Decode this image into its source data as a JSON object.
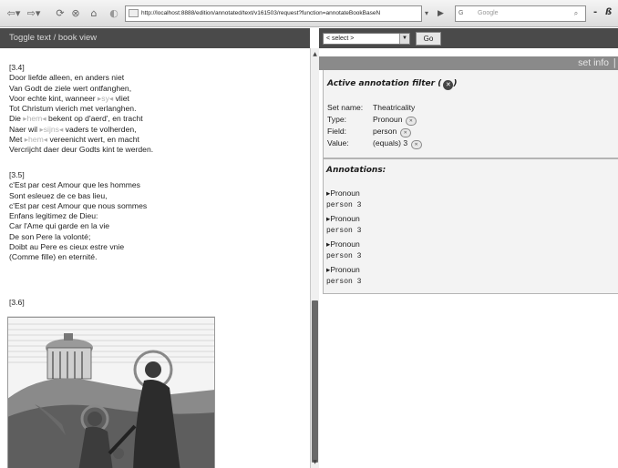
{
  "browser": {
    "url": "http://localhost:8888/edition/annotated/text/v161503/request?function=annotateBookBaseN",
    "search_placeholder": "Google",
    "search_engine_label": "G",
    "menu_dash": "-",
    "menu_extra": "ß"
  },
  "left": {
    "toggle_label": "Toggle text / book view",
    "stanza_34": {
      "number": "[3.4]",
      "lines": [
        [
          "Door liefde alleen, en anders niet",
          "",
          ""
        ],
        [
          "Van Godt de ziele wert ontfanghen,",
          "",
          ""
        ],
        [
          "Voor echte kint, wanneer ",
          "▸sy◂",
          " vliet"
        ],
        [
          "Tot Christum vierich met verlanghen.",
          "",
          ""
        ],
        [
          "Die ",
          "▸hem◂",
          " bekent op d'aerd', en tracht"
        ],
        [
          "Naer wil ",
          "▸sijns◂",
          " vaders te volherden,"
        ],
        [
          "Met ",
          "▸hem◂",
          " vereenicht wert, en macht"
        ],
        [
          "Vercrijcht daer deur Godts kint te werden.",
          "",
          ""
        ]
      ]
    },
    "stanza_35": {
      "number": "[3.5]",
      "lines": [
        "c'Est par cest Amour que les hommes",
        "Sont esleuez de ce bas lieu,",
        "c'Est par cest Amour que nous sommes",
        "Enfans legitimez de Dieu:",
        "Car l'Ame qui garde en la vie",
        "De son Pere la volonté;",
        "Doibt au Pere es cieux estre vnie",
        "(Comme fille) en eternité."
      ]
    },
    "stanza_36_number": "[3.6]"
  },
  "right": {
    "select_value": "< select >",
    "go_label": "Go",
    "set_info_label": "set info",
    "set_info_sep": "|",
    "filter": {
      "title": "Active annotation filter (",
      "title_end": ")",
      "rows": [
        {
          "label": "Set name:",
          "value": "Theatricality"
        },
        {
          "label": "Type:",
          "value": "Pronoun"
        },
        {
          "label": "Field:",
          "value": "person"
        },
        {
          "label": "Value:",
          "value": "(equals) 3"
        }
      ]
    },
    "annotations": {
      "title": "Annotations:",
      "items": [
        {
          "type": "▸Pronoun",
          "value": "person 3"
        },
        {
          "type": "▸Pronoun",
          "value": "person 3"
        },
        {
          "type": "▸Pronoun",
          "value": "person 3"
        },
        {
          "type": "▸Pronoun",
          "value": "person 3"
        }
      ]
    }
  },
  "icons": {
    "back": "back-arrow-icon",
    "forward": "forward-arrow-icon",
    "reload": "reload-icon",
    "stop": "stop-icon",
    "home": "home-icon",
    "remove": "remove-filter-icon",
    "close": "close-circle-icon"
  }
}
